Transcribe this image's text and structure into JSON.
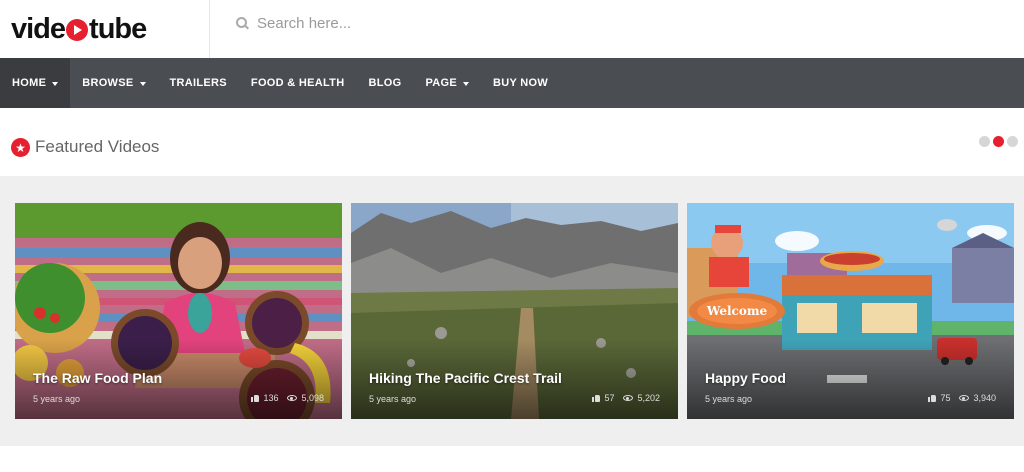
{
  "brand": {
    "part1": "vide",
    "part2": "tube"
  },
  "search": {
    "placeholder": "Search here..."
  },
  "nav": [
    {
      "label": "HOME",
      "dropdown": true,
      "active": true
    },
    {
      "label": "BROWSE",
      "dropdown": true
    },
    {
      "label": "TRAILERS"
    },
    {
      "label": "FOOD & HEALTH"
    },
    {
      "label": "BLOG"
    },
    {
      "label": "PAGE",
      "dropdown": true
    },
    {
      "label": "BUY NOW"
    }
  ],
  "featured": {
    "title": "Featured Videos"
  },
  "carousel": {
    "active_index": 1,
    "dot_count": 3
  },
  "colors": {
    "accent": "#e6202f",
    "nav_bg": "#4a4d52"
  },
  "videos": [
    {
      "title": "The Raw Food Plan",
      "age": "5 years ago",
      "likes": "136",
      "views": "5,098"
    },
    {
      "title": "Hiking The Pacific Crest Trail",
      "age": "5 years ago",
      "likes": "57",
      "views": "5,202"
    },
    {
      "title": "Happy Food",
      "age": "5 years ago",
      "likes": "75",
      "views": "3,940"
    }
  ]
}
